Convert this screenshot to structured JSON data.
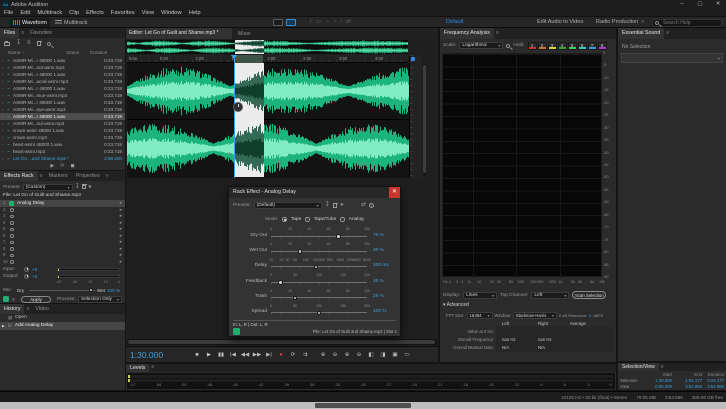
{
  "window": {
    "title": "Adobe Audition",
    "badge": "Au",
    "controls": {
      "minimize": "–",
      "maximize": "▢",
      "close": "✕"
    }
  },
  "menu": {
    "items": [
      "File",
      "Edit",
      "Multitrack",
      "Clip",
      "Effects",
      "Favorites",
      "View",
      "Window",
      "Help"
    ]
  },
  "toolbar": {
    "waveform_label": "Waveform",
    "multitrack_label": "Multitrack",
    "tools": [
      {
        "name": "time-selection-tool",
        "glyph": "I"
      },
      {
        "name": "marquee-selection-tool",
        "glyph": "▭"
      },
      {
        "name": "lasso-selection-tool",
        "glyph": "○"
      },
      {
        "name": "paintbrush-selection-tool",
        "glyph": "~"
      },
      {
        "name": "spot-healing-brush-tool",
        "glyph": "/"
      },
      {
        "name": "slip-tool",
        "glyph": "⇄"
      }
    ],
    "workspaces": [
      "Default",
      "Edit Audio to Video",
      "Radio Production"
    ],
    "overflow_glyph": "»",
    "search_placeholder": "Search Help"
  },
  "files": {
    "tabs": [
      "Files",
      "Favorites"
    ],
    "columns": {
      "name": "Name",
      "sort": "↑",
      "status": "Status",
      "duration": "Duration"
    },
    "rows": [
      {
        "name": "ASMR-Mi...r 48000 1.wav",
        "duration": "0:23.719"
      },
      {
        "name": "ASMR-Mi...oot-asmr.mp3",
        "duration": "0:23.719"
      },
      {
        "name": "ASMR-Mi...r 48000 1.wav",
        "duration": "0:23.719"
      },
      {
        "name": "ASMR-Mi...acral-asmr.mp3",
        "duration": "0:23.719"
      },
      {
        "name": "ASMR-Mi...r 48000 1.wav",
        "duration": "0:23.719"
      },
      {
        "name": "ASMR-Mi...mue-asmr.mp3",
        "duration": "0:23.719"
      },
      {
        "name": "ASMR-Mi...r 48000 1.wav",
        "duration": "0:23.719"
      },
      {
        "name": "ASMR-Mi...eye-asmr.mp3",
        "duration": "0:23.719"
      },
      {
        "name": "ASMR-Mi...r 48000 1.wav",
        "duration": "0:23.719",
        "selected": true
      },
      {
        "name": "ASMR-Mi...oul-asmr.mp3",
        "duration": "0:23.719"
      },
      {
        "name": "crown-asmr 48000 1.wav",
        "duration": "0:23.719"
      },
      {
        "name": "crown-asmr.mp3",
        "duration": "0:23.719"
      },
      {
        "name": "heart-asmr 48000 1.wav",
        "duration": "0:23.719"
      },
      {
        "name": "heart-asmr.mp3",
        "duration": "0:23.719"
      },
      {
        "name": "Let Go ...and Shame.mp3 *",
        "duration": "3:58.000",
        "accent": true
      }
    ]
  },
  "rack": {
    "tabs": [
      "Effects Rack",
      "Markers",
      "Properties"
    ],
    "overflow_glyph": "»",
    "presets_label": "Presets:",
    "preset_value": "(Custom)",
    "file_label": "File: Let Go of Guilt and Shame.mp3",
    "slots": [
      {
        "n": "1",
        "label": "Analog Delay",
        "on": true
      },
      {
        "n": "2"
      },
      {
        "n": "3"
      },
      {
        "n": "4"
      },
      {
        "n": "5"
      },
      {
        "n": "6"
      },
      {
        "n": "7"
      },
      {
        "n": "8"
      },
      {
        "n": "9"
      },
      {
        "n": "10"
      }
    ],
    "input_label": "Input:",
    "output_label": "Output:",
    "gain_value": "+0",
    "meter_scale": [
      "-48",
      "-36",
      "-24",
      "-12",
      "0"
    ],
    "mix_label": "Mix:",
    "dry_label": "Dry",
    "wet_label": "Wet",
    "mix_value": "100 %",
    "apply_label": "Apply",
    "process_label": "Process:",
    "process_value": "Selection Only"
  },
  "history": {
    "tabs": [
      "History",
      "Video"
    ],
    "items": [
      "Open",
      "Add Analog Delay"
    ],
    "selected_index": 1
  },
  "editor": {
    "tab": "Editor: Let Go of Guilt and Shame.mp3 *",
    "mixer_tab": "Mixer",
    "ruler_unit": "hms",
    "ruler_ticks": [
      "0:30",
      "1:00",
      "1:30",
      "2:00",
      "2:30",
      "3:00",
      "3:30"
    ],
    "time_display": "1:30.000"
  },
  "transport": {
    "buttons": [
      {
        "name": "stop-button",
        "glyph": "■"
      },
      {
        "name": "play-button",
        "glyph": "▶"
      },
      {
        "name": "pause-button",
        "glyph": "▮▮"
      },
      {
        "name": "skip-to-start-button",
        "glyph": "|◀"
      },
      {
        "name": "rewind-button",
        "glyph": "◀◀"
      },
      {
        "name": "fast-forward-button",
        "glyph": "▶▶"
      },
      {
        "name": "skip-to-end-button",
        "glyph": "▶|"
      },
      {
        "name": "record-button",
        "glyph": "●",
        "color": "#e04545"
      },
      {
        "name": "loop-playback-button",
        "glyph": "⟳"
      },
      {
        "name": "skip-selection-button",
        "glyph": "⇉"
      }
    ],
    "zoom_tools": [
      {
        "name": "zoom-in-time-button",
        "glyph": "⊕"
      },
      {
        "name": "zoom-out-time-button",
        "glyph": "⊖"
      },
      {
        "name": "zoom-in-amplitude-button",
        "glyph": "⊕"
      },
      {
        "name": "zoom-out-amplitude-button",
        "glyph": "⊖"
      },
      {
        "name": "zoom-to-in-point-button",
        "glyph": "◧"
      },
      {
        "name": "zoom-to-out-point-button",
        "glyph": "◨"
      },
      {
        "name": "zoom-to-selection-button",
        "glyph": "▣"
      },
      {
        "name": "zoom-full-button",
        "glyph": "▭"
      }
    ]
  },
  "levels": {
    "tab": "Levels",
    "scale": [
      "-57",
      "-54",
      "-51",
      "-48",
      "-45",
      "-42",
      "-39",
      "-36",
      "-33",
      "-30",
      "-27",
      "-24",
      "-21",
      "-18",
      "-15",
      "-12",
      "-9",
      "-6",
      "-3",
      "0"
    ]
  },
  "frequency": {
    "tab": "Frequency Analysis",
    "scale_label": "Scale:",
    "scale_value": "Logarithmic",
    "hold_label": "Hold:",
    "hold_buttons": [
      {
        "n": "1",
        "color": "#c83232"
      },
      {
        "n": "2",
        "color": "#d2722a"
      },
      {
        "n": "3",
        "color": "#d8d23a"
      },
      {
        "n": "4",
        "color": "#3f9e3f"
      },
      {
        "n": "5",
        "color": "#3fd05a"
      },
      {
        "n": "6",
        "color": "#35c8c8"
      },
      {
        "n": "7",
        "color": "#3a9ad8"
      },
      {
        "n": "8",
        "color": "#b43ad2"
      }
    ],
    "db_labels": [
      "0",
      "-5",
      "-10",
      "-15",
      "-20",
      "-25",
      "-30",
      "-35",
      "-40",
      "-45",
      "-50",
      "-55",
      "-60",
      "-65",
      "-70",
      "-75",
      "-80",
      "-85",
      "-90"
    ],
    "freq_unit": "Hz",
    "freq_labels": [
      "2",
      "3",
      "4",
      "6",
      "10",
      "20",
      "30",
      "60",
      "100",
      "200",
      "300",
      "600",
      "1k",
      "2k",
      "3k",
      "6k",
      "10k"
    ],
    "display_label": "Display:",
    "display_value": "Lines",
    "top_channel_label": "Top Channel:",
    "top_channel_value": "Left",
    "scan_button": "Scan Selection",
    "advanced_caret": "▾",
    "advanced_label": "Advanced",
    "fft_label": "FFT Size:",
    "fft_value": "16384",
    "window_label": "Window:",
    "window_value": "Blackman-Harris",
    "reference_label": "0 dB Reference:",
    "reference_value": "0",
    "reference_unit": "dBFS",
    "table": {
      "columns": [
        "Left",
        "Right",
        "Average"
      ],
      "rows": [
        {
          "label": "Value at 0 Hz:",
          "left": "",
          "right": "",
          "avg": ""
        },
        {
          "label": "Overall Frequency:",
          "left": "nan Hz",
          "right": "nan Hz",
          "avg": ""
        },
        {
          "label": "Overall Musical Note:",
          "left": "N/A",
          "right": "N/A",
          "avg": ""
        }
      ]
    }
  },
  "essential": {
    "tab": "Essential Sound",
    "empty_text": "No Selection"
  },
  "selection_view": {
    "tab": "Selection/View",
    "columns": [
      "Start",
      "End",
      "Duration"
    ],
    "rows": [
      {
        "label": "Selection",
        "start": "1:30.000",
        "end": "1:54.177",
        "duration": "0:24.177"
      },
      {
        "label": "View",
        "start": "0:00.000",
        "end": "3:54.960",
        "duration": "3:54.960"
      }
    ]
  },
  "dialog": {
    "title": "Rack Effect - Analog Delay",
    "presets_label": "Presets:",
    "preset_value": "(Default)",
    "mode_label": "Mode:",
    "modes": [
      {
        "label": "Tape",
        "selected": true
      },
      {
        "label": "Tape/Tube",
        "selected": false
      },
      {
        "label": "Analog",
        "selected": false
      }
    ],
    "sliders": [
      {
        "label": "Dry Out",
        "value": 70,
        "min": 0,
        "max": 100,
        "ticks": [
          0,
          20,
          40,
          60,
          80,
          100
        ],
        "display": "70 %"
      },
      {
        "label": "Wet Out",
        "value": 30,
        "min": 0,
        "max": 100,
        "ticks": [
          0,
          20,
          40,
          60,
          80,
          100
        ],
        "display": "30 %"
      },
      {
        "label": "Delay",
        "value": 200,
        "min": 10,
        "max": 6000,
        "log": true,
        "ticks": [
          10,
          20,
          30,
          50,
          100,
          200,
          300,
          500,
          1000,
          2000,
          3000,
          6000
        ],
        "display": "200 ms"
      },
      {
        "label": "Feedback",
        "value": 20,
        "min": 0,
        "max": 200,
        "ticks": [
          0,
          50,
          100,
          150,
          200
        ],
        "display": "20 %"
      },
      {
        "label": "Trash",
        "value": 25,
        "min": 0,
        "max": 100,
        "ticks": [
          0,
          20,
          40,
          60,
          80,
          100
        ],
        "display": "25 %"
      },
      {
        "label": "Spread",
        "value": 100,
        "min": 0,
        "max": 200,
        "ticks": [
          0,
          50,
          100,
          150,
          200
        ],
        "display": "100 %"
      }
    ],
    "io_label": "In: L, R | Out: L, R",
    "footer_label": "File: Let Go of Guilt and Shame.mp3  |  Slot 1"
  },
  "status": {
    "format": "44100 Hz • 32-bit (float) • Stereo",
    "size": "79.05 MB",
    "duration": "3:54.960",
    "free": "309.06 GB free"
  }
}
